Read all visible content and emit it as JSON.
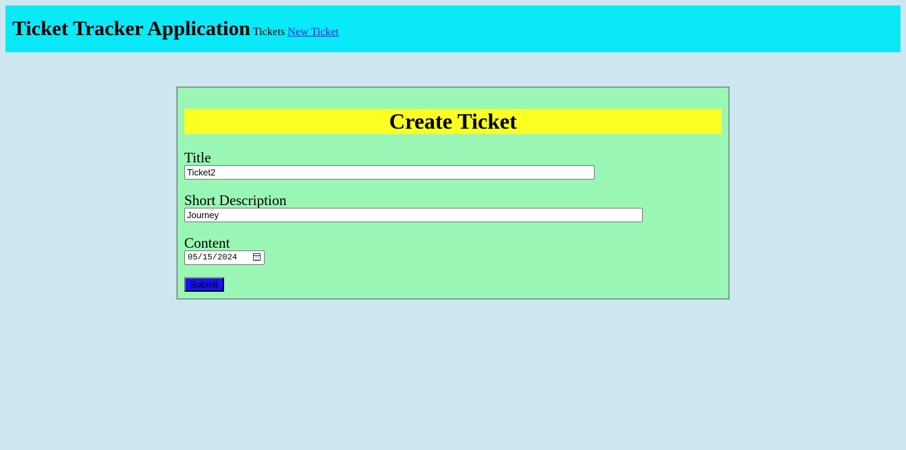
{
  "header": {
    "app_title": "Ticket Tracker Application",
    "nav": {
      "tickets_label": "Tickets",
      "new_ticket_label": "New Ticket"
    }
  },
  "form": {
    "heading": "Create Ticket",
    "fields": {
      "title": {
        "label": "Title",
        "value": "Ticket2"
      },
      "short_description": {
        "label": "Short Description",
        "value": "Journey"
      },
      "content": {
        "label": "Content",
        "value": "05/15/2024"
      }
    },
    "submit_label": "Submit"
  },
  "colors": {
    "page_background": "#cde6ef",
    "header_background": "#0ae9f7",
    "form_background": "#9af6b4",
    "form_heading_background": "#fbff22",
    "submit_background": "#1212ff",
    "link_color": "#2a2ad8"
  },
  "icons": {
    "date_picker": "calendar-icon"
  }
}
